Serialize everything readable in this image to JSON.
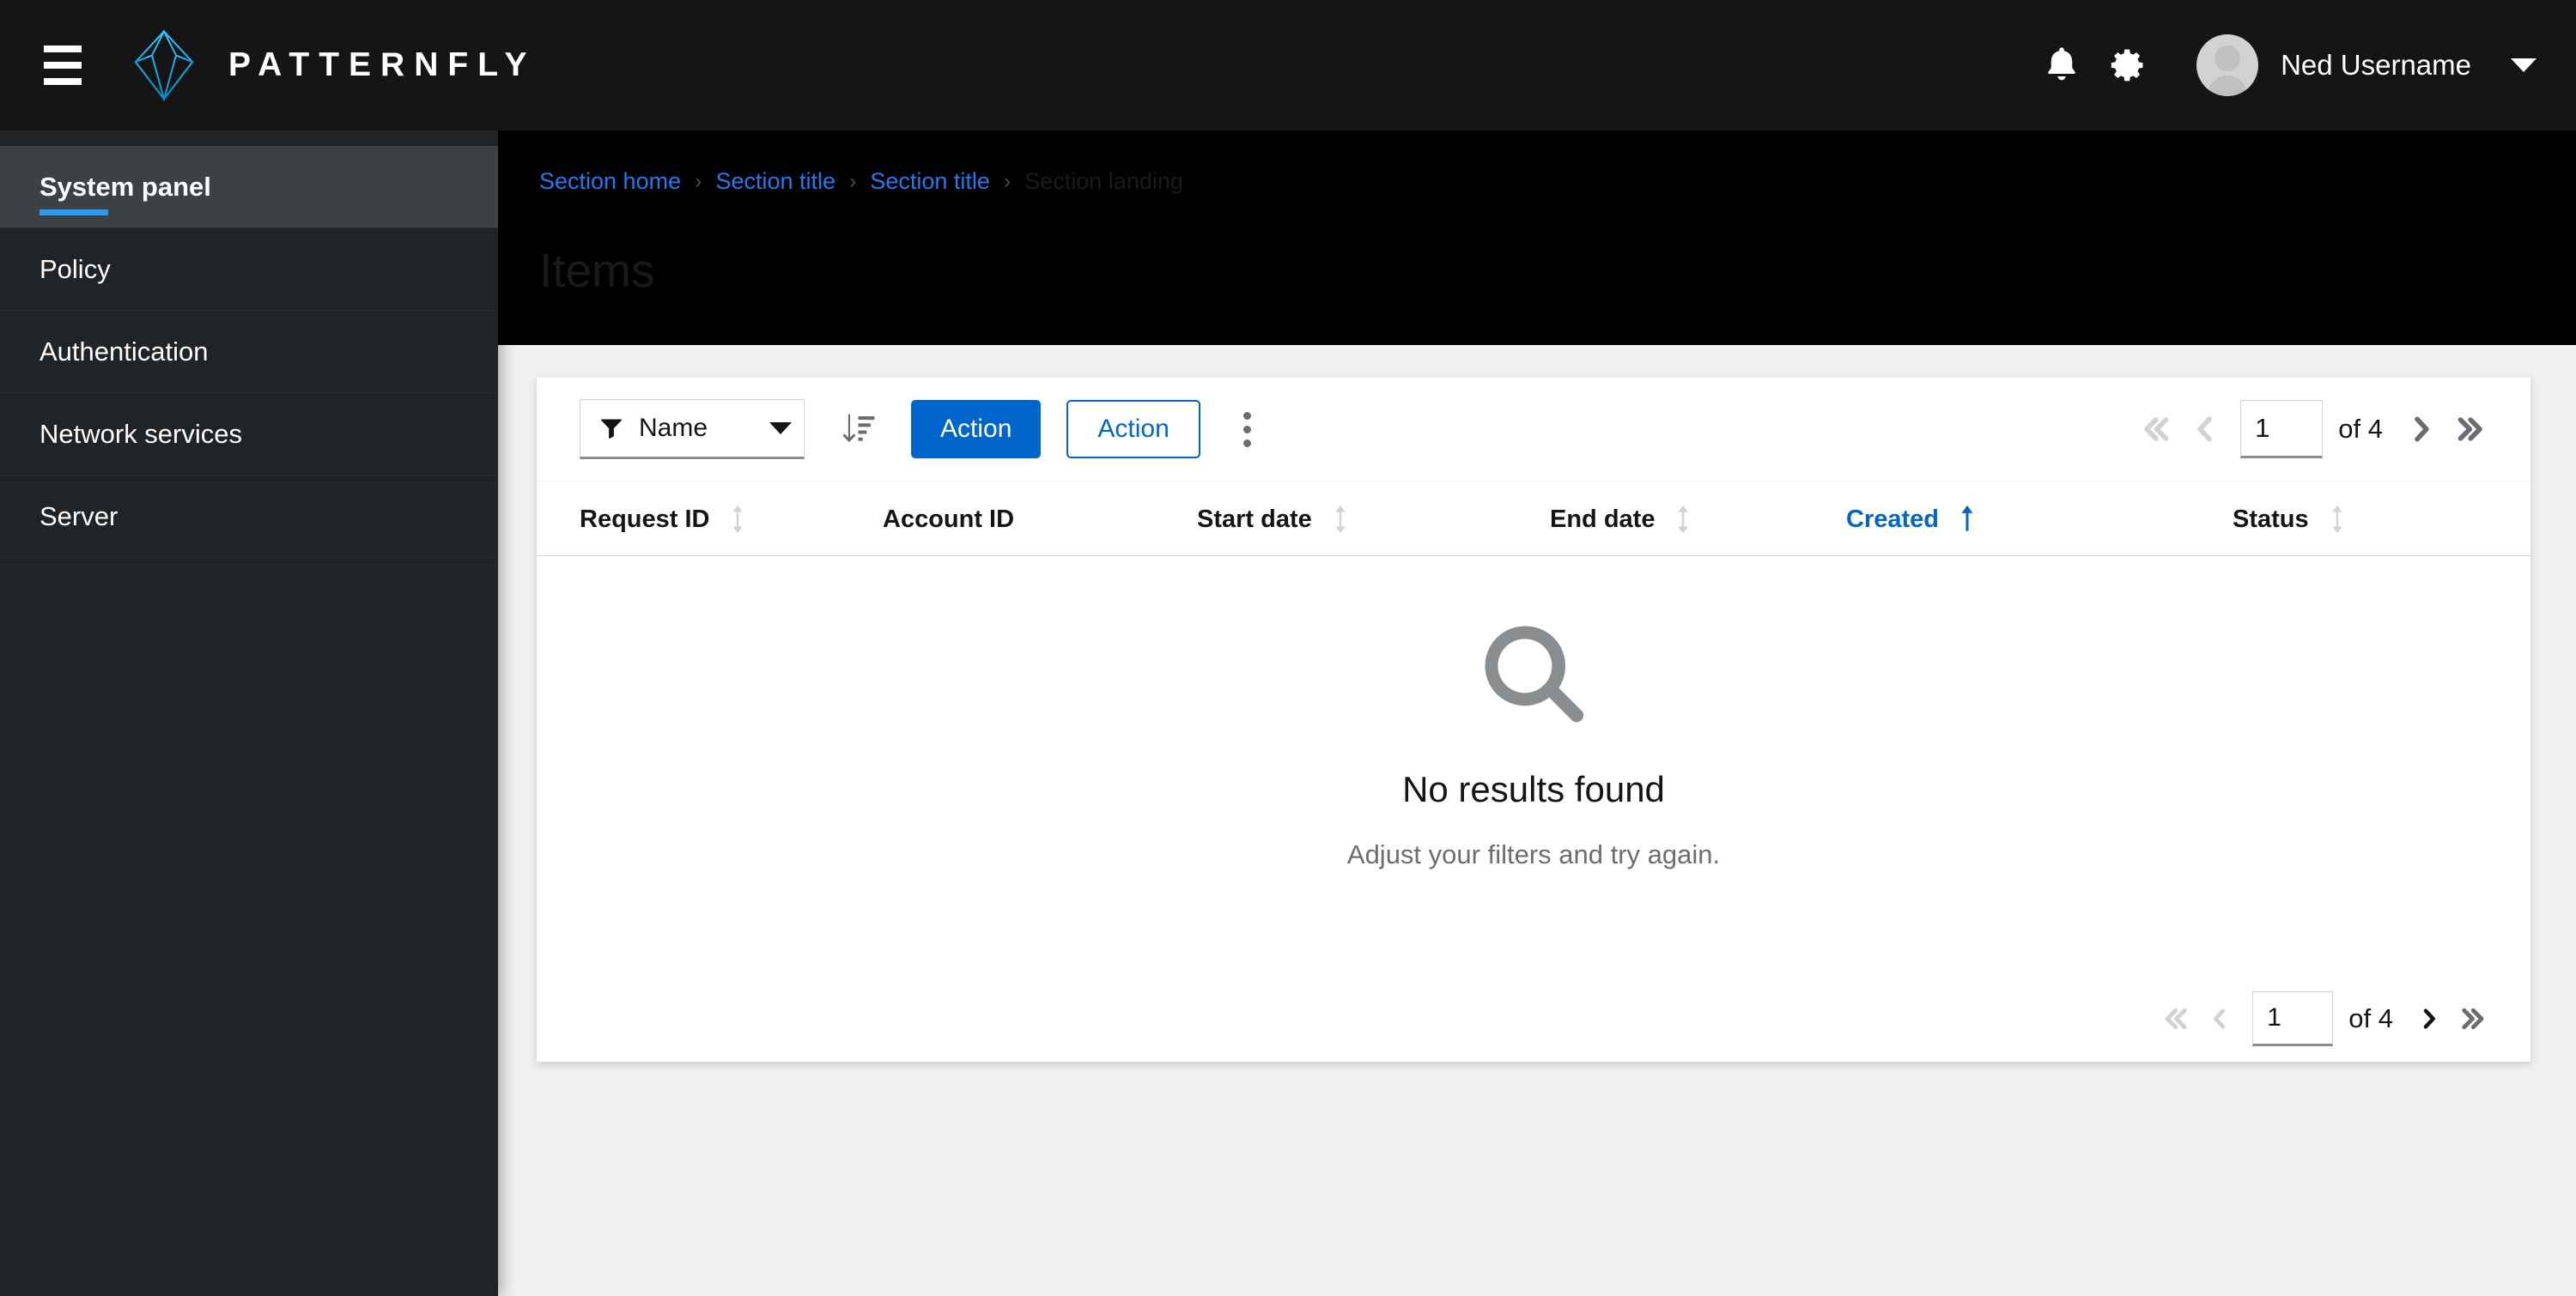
{
  "masthead": {
    "menu_toggle": "Global navigation",
    "brand_name": "PATTERNFLY",
    "notifications_icon": "bell-icon",
    "settings_icon": "gear-icon",
    "username": "Ned Username",
    "user_caret_icon": "caret-down-icon"
  },
  "sidebar": {
    "items": [
      {
        "label": "System panel",
        "active": true
      },
      {
        "label": "Policy",
        "active": false
      },
      {
        "label": "Authentication",
        "active": false
      },
      {
        "label": "Network services",
        "active": false
      },
      {
        "label": "Server",
        "active": false
      }
    ]
  },
  "page_header": {
    "breadcrumb": [
      {
        "label": "Section home",
        "current": false
      },
      {
        "label": "Section title",
        "current": false
      },
      {
        "label": "Section title",
        "current": false
      },
      {
        "label": "Section landing",
        "current": true
      }
    ],
    "separator": "›",
    "title": "Items"
  },
  "toolbar": {
    "filter": {
      "icon": "filter-icon",
      "label": "Name",
      "caret": "caret-down-icon"
    },
    "sort_icon": "sort-amount-down-icon",
    "primary_action": "Action",
    "secondary_action": "Action",
    "kebab_icon": "kebab-menu-icon"
  },
  "pagination_top": {
    "first_icon": "angle-double-left-icon",
    "prev_icon": "angle-left-icon",
    "page_value": "1",
    "page_placeholder": "1",
    "of_label": "of 4",
    "next_icon": "angle-right-icon",
    "last_icon": "angle-double-right-icon",
    "first_disabled": true,
    "prev_disabled": true
  },
  "pagination_bottom": {
    "first_icon": "angle-double-left-icon",
    "prev_icon": "angle-left-icon",
    "page_value": "1",
    "page_placeholder": "1",
    "of_label": "of 4",
    "next_icon": "angle-right-icon",
    "last_icon": "angle-double-right-icon",
    "first_disabled": true,
    "prev_disabled": true
  },
  "table": {
    "columns": [
      {
        "label": "Request ID",
        "sortable": true,
        "sorted": false
      },
      {
        "label": "Account ID",
        "sortable": false,
        "sorted": false
      },
      {
        "label": "Start date",
        "sortable": true,
        "sorted": false
      },
      {
        "label": "End date",
        "sortable": true,
        "sorted": false
      },
      {
        "label": "Created",
        "sortable": true,
        "sorted": true,
        "direction": "asc"
      },
      {
        "label": "Status",
        "sortable": true,
        "sorted": false
      }
    ],
    "rows": []
  },
  "empty_state": {
    "icon": "search-icon",
    "title": "No results found",
    "body": "Adjust your filters and try again."
  },
  "colors": {
    "brand_accent": "#2b9af3",
    "link": "#0066cc",
    "primary_button": "#0066cc",
    "masthead_bg": "#151515",
    "sidebar_bg": "#212427",
    "sidebar_active_bg": "#3c4145",
    "page_bg": "#f0f0f0",
    "header_band_bg": "#000000",
    "muted_text": "#6a6e73"
  }
}
